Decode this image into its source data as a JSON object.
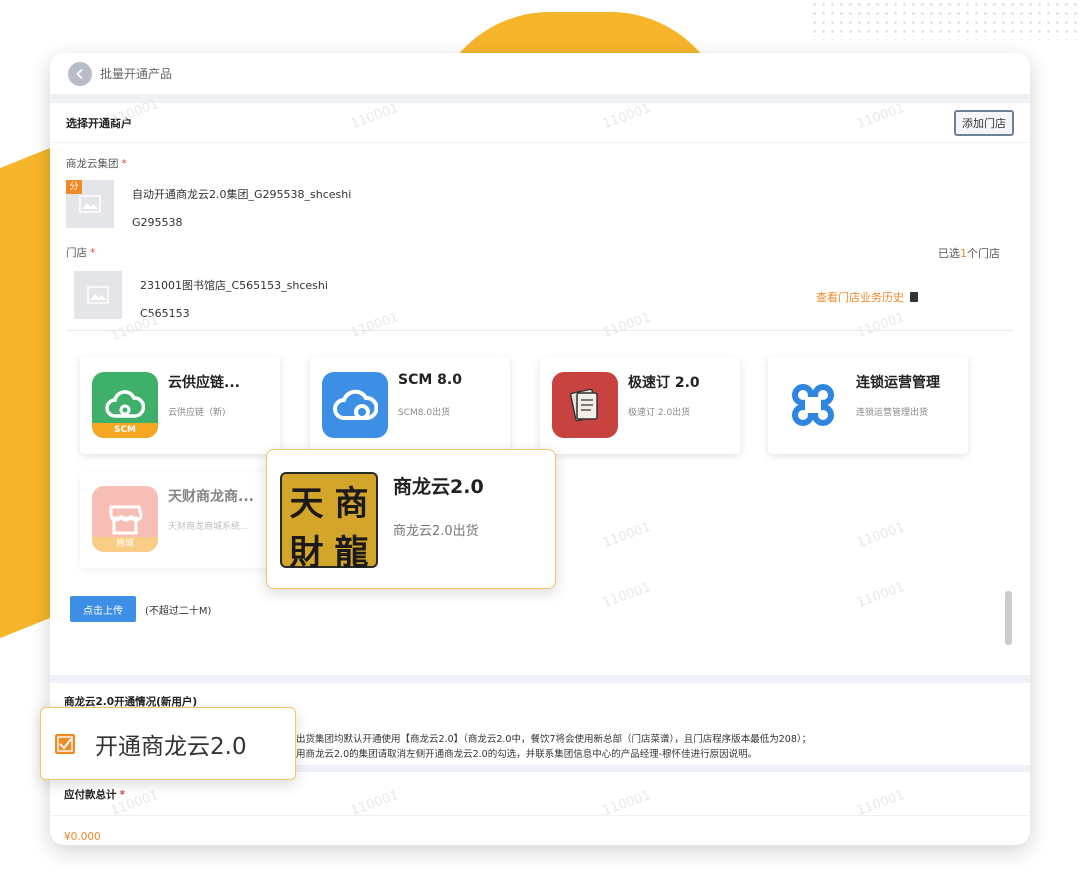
{
  "header": {
    "title": "批量开通产品"
  },
  "merchant_section": {
    "title": "选择开通商户",
    "add_store_label": "添加门店"
  },
  "group": {
    "label": "商龙云集团",
    "required_mark": "*",
    "badge": "分",
    "name": "自动开通商龙云2.0集团_G295538_shceshi",
    "code": "G295538"
  },
  "store": {
    "label": "门店",
    "required_mark": "*",
    "selected_prefix": "已选",
    "selected_count": "1",
    "selected_suffix": "个门店",
    "name": "231001图书馆店_C565153_shceshi",
    "code": "C565153",
    "history_link": "查看门店业务历史"
  },
  "products": [
    {
      "title": "云供应链...",
      "subtitle": "云供应链（新)",
      "icon_badge": "SCM",
      "color": "#3fb06a"
    },
    {
      "title": "SCM 8.0",
      "subtitle": "SCM8.0出货",
      "color": "#3d8fe6"
    },
    {
      "title": "极速订 2.0",
      "subtitle": "极速订 2.0出货",
      "color": "#c8423f"
    },
    {
      "title": "连锁运营管理",
      "subtitle": "连锁运营管理出货",
      "color": "#2f86e0"
    },
    {
      "title": "天财商龙商...",
      "subtitle": "天财商龙商城系统...",
      "icon_badge": "商城",
      "color": "#f08a7a"
    }
  ],
  "popup_product": {
    "logo_chars": [
      "天",
      "商",
      "財",
      "龍"
    ],
    "title": "商龙云2.0",
    "subtitle": "商龙云2.0出货"
  },
  "upload": {
    "button_label": "点击上传",
    "note": "(不超过二十M)"
  },
  "status": {
    "title": "商龙云2.0开通情况(新用户)",
    "line1": "出货集团均默认开通使用【商龙云2.0】（商龙云2.0中，餐饮7将会使用新总部（门店菜谱），且门店程序版本最低为208）；",
    "line2": "用商龙云2.0的集团请取消左侧开通商龙云2.0的勾选，并联系集团信息中心的产品经理-穆怀佳进行原因说明。",
    "checkbox_label": "开通商龙云2.0",
    "checkbox_checked": true
  },
  "payable": {
    "title": "应付款总计",
    "required_mark": "*",
    "value": "¥0.000"
  },
  "watermark": "110001",
  "colors": {
    "accent": "#f08a24",
    "primary": "#3d8fe6",
    "background_blob": "#f6b52a"
  }
}
